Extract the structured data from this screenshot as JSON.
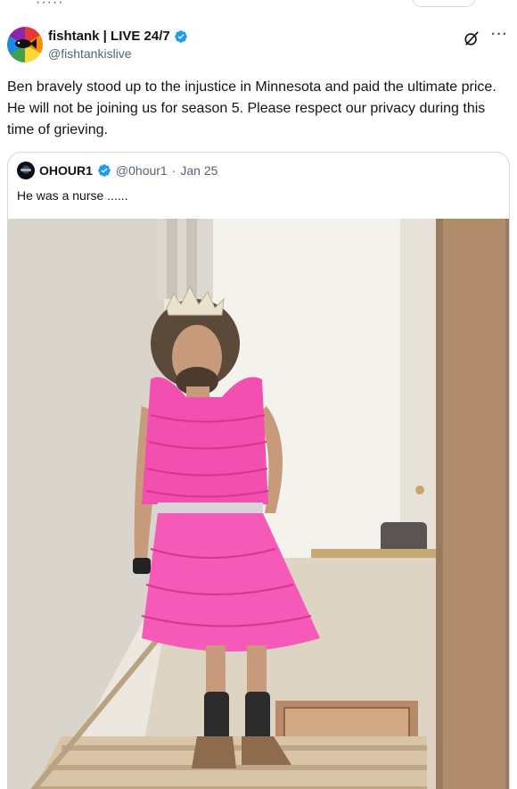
{
  "header": {
    "display_name": "fishtank | LIVE 24/7",
    "handle": "@fishtankislive",
    "avatar_icon": "fishtank-rainbow-logo",
    "verified_icon": "verified-badge-icon",
    "more_icon": "more-options-icon",
    "grok_icon": "grok-icon"
  },
  "tweet": {
    "text": "Ben bravely stood up to the injustice in Minnesota and paid the ultimate price. He will not be joining us for season 5. Please respect our privacy during this time of grieving."
  },
  "quote": {
    "display_name": "OHOUR1",
    "handle": "@0hour1",
    "separator": "·",
    "date": "Jan 25",
    "text": "He was a nurse ......",
    "media_description": "photo-man-pink-ruffled-dress-tiara-on-stairs"
  },
  "colors": {
    "text_primary": "#0f1419",
    "text_secondary": "#536471",
    "verified_blue": "#1d9bf0",
    "border": "#cfd9de",
    "dress_pink": "#f24fb0"
  }
}
